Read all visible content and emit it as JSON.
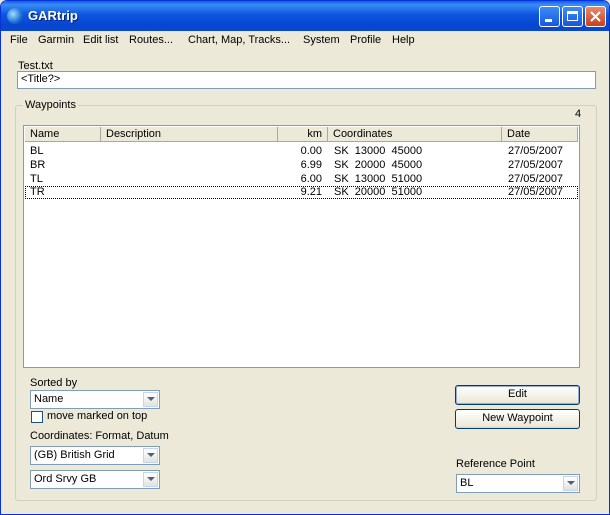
{
  "window": {
    "title": "GARtrip"
  },
  "menu": [
    {
      "label": "File"
    },
    {
      "label": "Garmin"
    },
    {
      "label": "Edit list"
    },
    {
      "label": "Routes..."
    },
    {
      "label": "Chart, Map, Tracks..."
    },
    {
      "label": "System"
    },
    {
      "label": "Profile"
    },
    {
      "label": "Help"
    }
  ],
  "file_name": "Test.txt",
  "title_field": {
    "value": "<Title?>"
  },
  "waypoints": {
    "group_label": "Waypoints",
    "count": "4",
    "columns": [
      "Name",
      "Description",
      "km",
      "Coordinates",
      "Date"
    ],
    "rows": [
      {
        "name": "BL",
        "description": "",
        "km": "0.00",
        "coordinates": "SK  13000  45000",
        "date": "27/05/2007"
      },
      {
        "name": "BR",
        "description": "",
        "km": "6.99",
        "coordinates": "SK  20000  45000",
        "date": "27/05/2007"
      },
      {
        "name": "TL",
        "description": "",
        "km": "6.00",
        "coordinates": "SK  13000  51000",
        "date": "27/05/2007"
      },
      {
        "name": "TR",
        "description": "",
        "km": "9.21",
        "coordinates": "SK  20000  51000",
        "date": "27/05/2007"
      }
    ]
  },
  "sort": {
    "label": "Sorted by",
    "value": "Name",
    "move_marked_label": "move marked on top",
    "move_marked_checked": false
  },
  "coords": {
    "label": "Coordinates: Format, Datum",
    "format": "(GB) British Grid",
    "datum": "Ord Srvy GB"
  },
  "buttons": {
    "edit": "Edit",
    "new_waypoint": "New Waypoint"
  },
  "reference": {
    "label": "Reference Point",
    "value": "BL"
  }
}
